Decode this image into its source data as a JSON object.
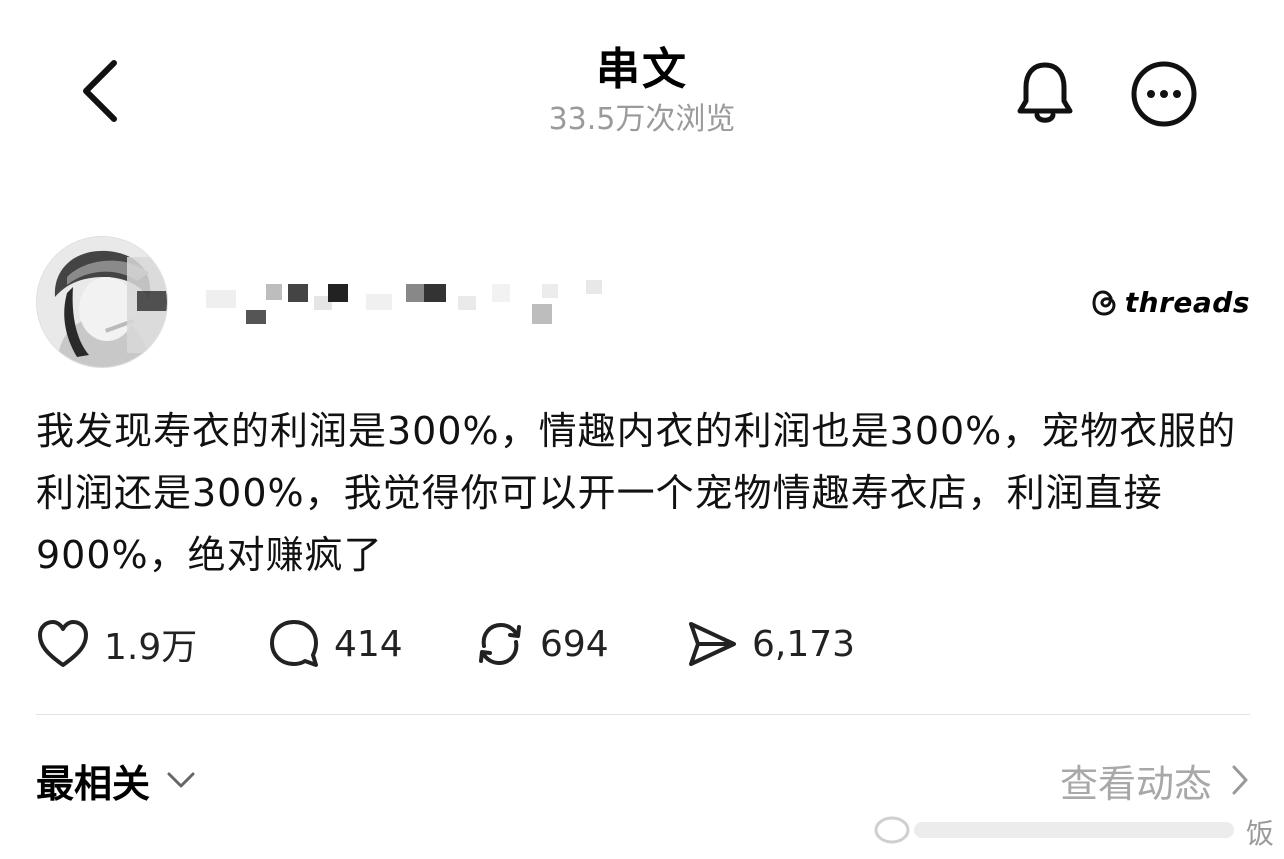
{
  "header": {
    "title": "串文",
    "views": "33.5万次浏览",
    "back_icon": "chevron-left-icon",
    "bell_icon": "bell-icon",
    "more_icon": "more-horizontal-icon"
  },
  "author": {
    "threads_label": "threads"
  },
  "post": {
    "text": "我发现寿衣的利润是300%，情趣内衣的利润也是300%，宠物衣服的利润还是300%，我觉得你可以开一个宠物情趣寿衣店，利润直接900%，绝对赚疯了"
  },
  "actions": {
    "likes": "1.9万",
    "comments": "414",
    "reposts": "694",
    "shares": "6,173"
  },
  "sort": {
    "label": "最相关",
    "activity_label": "查看动态"
  },
  "watermark": {
    "text": "饭"
  }
}
